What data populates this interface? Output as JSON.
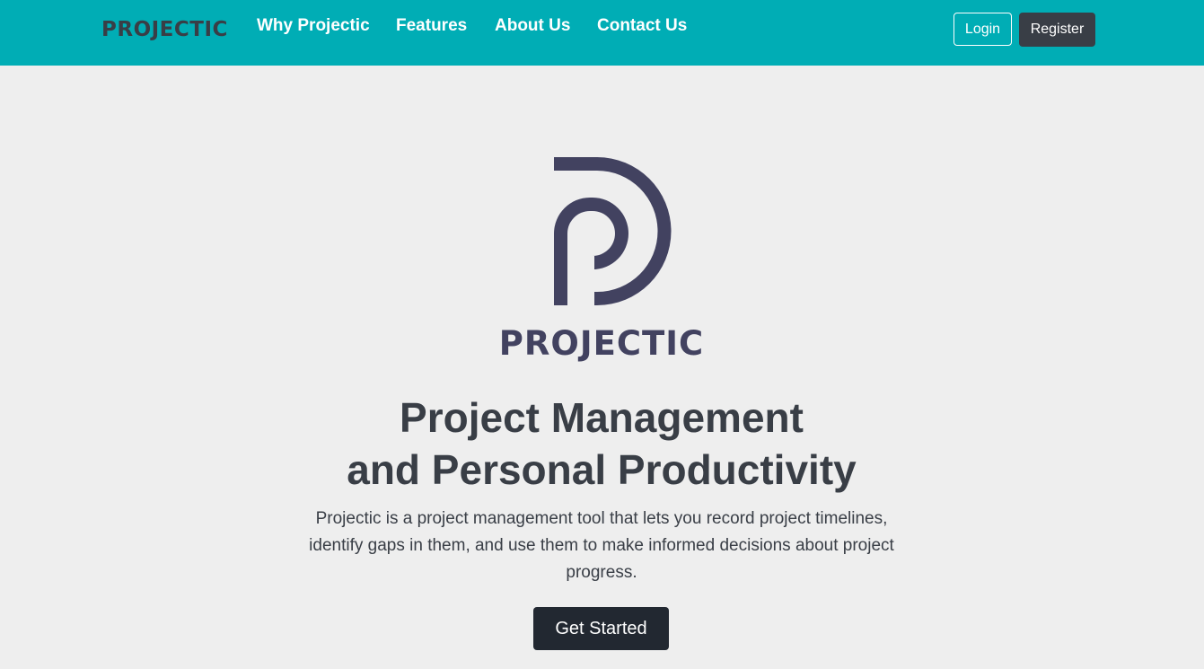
{
  "navbar": {
    "brand": "PROJECTIC",
    "links": [
      "Why Projectic",
      "Features",
      "About Us",
      "Contact Us"
    ],
    "login_label": "Login",
    "register_label": "Register"
  },
  "hero": {
    "logo_text": "PROJECTIC",
    "headline_line1": "Project Management",
    "headline_line2": "and Personal Productivity",
    "description": "Projectic is a project management tool that lets you record project timelines, identify gaps in them, and use them to make informed decisions about project progress.",
    "cta_label": "Get Started"
  },
  "colors": {
    "navbar_bg": "#00adb5",
    "page_bg": "#eeeeee",
    "dark": "#393e46",
    "darkest": "#222831",
    "logo": "#424260"
  }
}
